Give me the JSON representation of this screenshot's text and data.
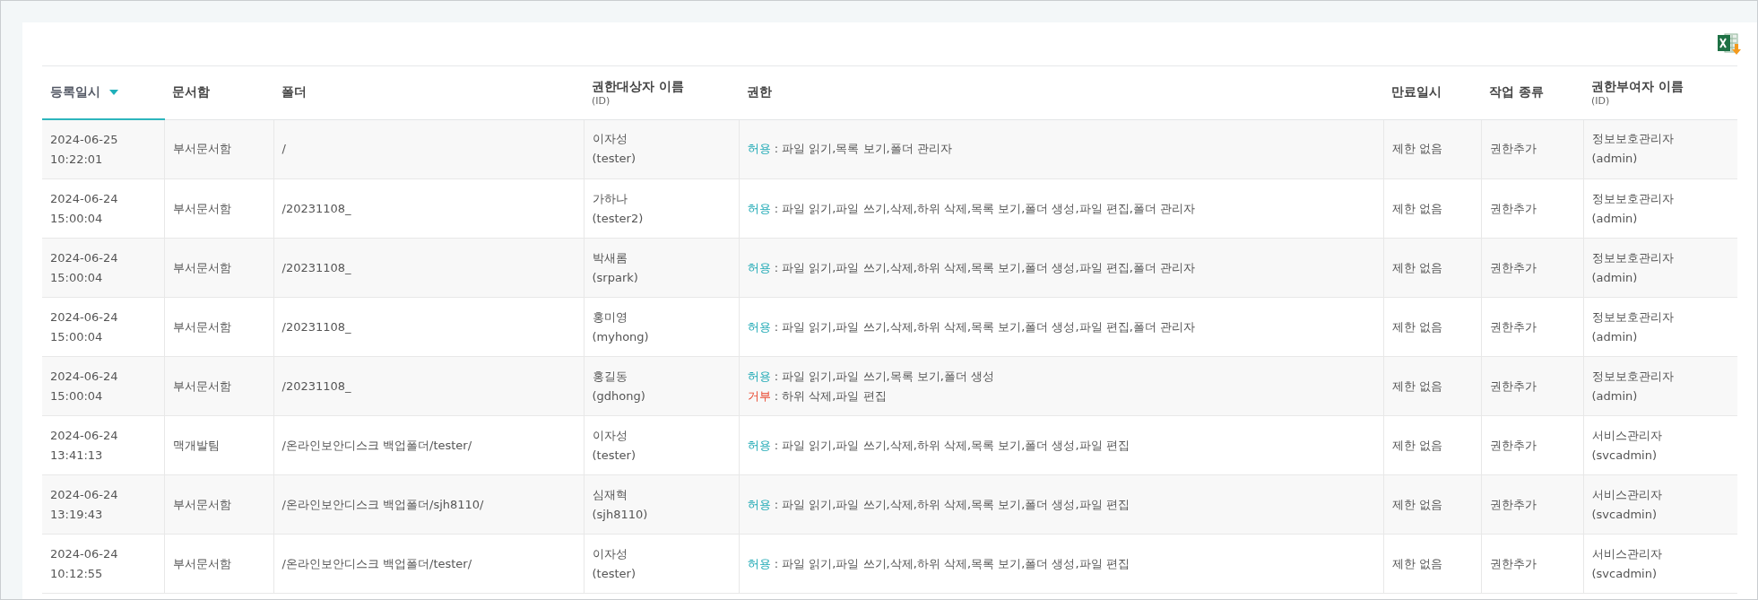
{
  "table": {
    "columns": [
      {
        "label": "등록일시",
        "sorted": true
      },
      {
        "label": "문서함",
        "sorted": false
      },
      {
        "label": "폴더",
        "sorted": false
      },
      {
        "label": "권한대상자 이름",
        "sub": "(ID)",
        "sorted": false
      },
      {
        "label": "권한",
        "sorted": false
      },
      {
        "label": "만료일시",
        "sorted": false
      },
      {
        "label": "작업 종류",
        "sorted": false
      },
      {
        "label": "권한부여자 이름",
        "sub": "(ID)",
        "sorted": false
      }
    ],
    "rows": [
      {
        "date": "2024-06-25",
        "time": "10:22:01",
        "box": "부서문서함",
        "folder": "/",
        "name": "이자성",
        "id": "(tester)",
        "perms": [
          {
            "kind": "allow",
            "label": "허용",
            "text": ": 파일 읽기,목록 보기,폴더 관리자"
          }
        ],
        "expiry": "제한 없음",
        "action": "권한추가",
        "grantor": "정보보호관리자",
        "grantor_id": "(admin)"
      },
      {
        "date": "2024-06-24",
        "time": "15:00:04",
        "box": "부서문서함",
        "folder": "/20231108_",
        "name": "가하나",
        "id": "(tester2)",
        "perms": [
          {
            "kind": "allow",
            "label": "허용",
            "text": ": 파일 읽기,파일 쓰기,삭제,하위 삭제,목록 보기,폴더 생성,파일 편집,폴더 관리자"
          }
        ],
        "expiry": "제한 없음",
        "action": "권한추가",
        "grantor": "정보보호관리자",
        "grantor_id": "(admin)"
      },
      {
        "date": "2024-06-24",
        "time": "15:00:04",
        "box": "부서문서함",
        "folder": "/20231108_",
        "name": "박새롬",
        "id": "(srpark)",
        "perms": [
          {
            "kind": "allow",
            "label": "허용",
            "text": ": 파일 읽기,파일 쓰기,삭제,하위 삭제,목록 보기,폴더 생성,파일 편집,폴더 관리자"
          }
        ],
        "expiry": "제한 없음",
        "action": "권한추가",
        "grantor": "정보보호관리자",
        "grantor_id": "(admin)"
      },
      {
        "date": "2024-06-24",
        "time": "15:00:04",
        "box": "부서문서함",
        "folder": "/20231108_",
        "name": "홍미영",
        "id": "(myhong)",
        "perms": [
          {
            "kind": "allow",
            "label": "허용",
            "text": ": 파일 읽기,파일 쓰기,삭제,하위 삭제,목록 보기,폴더 생성,파일 편집,폴더 관리자"
          }
        ],
        "expiry": "제한 없음",
        "action": "권한추가",
        "grantor": "정보보호관리자",
        "grantor_id": "(admin)"
      },
      {
        "date": "2024-06-24",
        "time": "15:00:04",
        "box": "부서문서함",
        "folder": "/20231108_",
        "name": "홍길동",
        "id": "(gdhong)",
        "perms": [
          {
            "kind": "allow",
            "label": "허용",
            "text": ": 파일 읽기,파일 쓰기,목록 보기,폴더 생성"
          },
          {
            "kind": "deny",
            "label": "거부",
            "text": ": 하위 삭제,파일 편집"
          }
        ],
        "expiry": "제한 없음",
        "action": "권한추가",
        "grantor": "정보보호관리자",
        "grantor_id": "(admin)"
      },
      {
        "date": "2024-06-24",
        "time": "13:41:13",
        "box": "맥개발팀",
        "folder": "/온라인보안디스크 백업폴더/tester/",
        "name": "이자성",
        "id": "(tester)",
        "perms": [
          {
            "kind": "allow",
            "label": "허용",
            "text": ": 파일 읽기,파일 쓰기,삭제,하위 삭제,목록 보기,폴더 생성,파일 편집"
          }
        ],
        "expiry": "제한 없음",
        "action": "권한추가",
        "grantor": "서비스관리자",
        "grantor_id": "(svcadmin)"
      },
      {
        "date": "2024-06-24",
        "time": "13:19:43",
        "box": "부서문서함",
        "folder": "/온라인보안디스크 백업폴더/sjh8110/",
        "name": "심재혁",
        "id": "(sjh8110)",
        "perms": [
          {
            "kind": "allow",
            "label": "허용",
            "text": ": 파일 읽기,파일 쓰기,삭제,하위 삭제,목록 보기,폴더 생성,파일 편집"
          }
        ],
        "expiry": "제한 없음",
        "action": "권한추가",
        "grantor": "서비스관리자",
        "grantor_id": "(svcadmin)"
      },
      {
        "date": "2024-06-24",
        "time": "10:12:55",
        "box": "부서문서함",
        "folder": "/온라인보안디스크 백업폴더/tester/",
        "name": "이자성",
        "id": "(tester)",
        "perms": [
          {
            "kind": "allow",
            "label": "허용",
            "text": ": 파일 읽기,파일 쓰기,삭제,하위 삭제,목록 보기,폴더 생성,파일 편집"
          }
        ],
        "expiry": "제한 없음",
        "action": "권한추가",
        "grantor": "서비스관리자",
        "grantor_id": "(svcadmin)"
      }
    ]
  }
}
